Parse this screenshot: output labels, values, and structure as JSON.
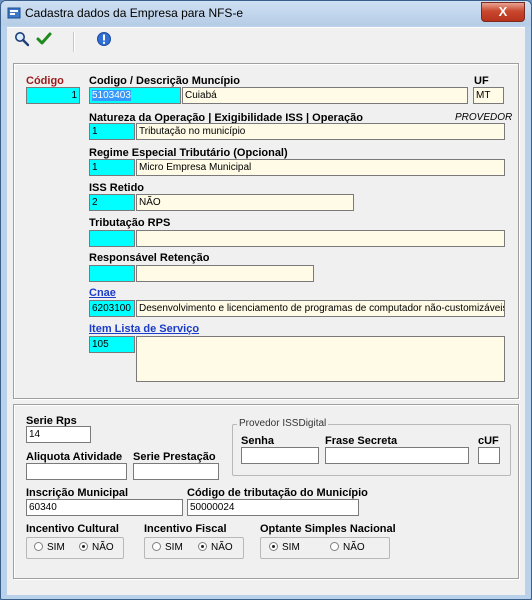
{
  "window": {
    "title": "Cadastra dados da Empresa para NFS-e",
    "close_label": "X"
  },
  "toolbar": {
    "search_icon": "search-icon",
    "confirm_icon": "checkmark-icon",
    "info_icon": "info-icon",
    "confirm_color": "#1e8a1e",
    "info_color": "#2f6fd6"
  },
  "codigo": {
    "label": "Código",
    "value": "1"
  },
  "municipio": {
    "label": "Codigo / Descrição Muncípio",
    "code": "5103403",
    "name": "Cuiabá"
  },
  "uf": {
    "label": "UF",
    "value": "MT"
  },
  "natureza": {
    "label": "Natureza da Operação | Exigibilidade ISS | Operação",
    "note": "PROVEDOR",
    "code": "1",
    "desc": "Tributação no município"
  },
  "regime": {
    "label": "Regime Especial Tributário (Opcional)",
    "code": "1",
    "desc": "Micro Empresa Municipal"
  },
  "iss_retido": {
    "label": "ISS Retido",
    "code": "2",
    "desc": "NÃO"
  },
  "tributacao_rps": {
    "label": "Tributação RPS",
    "code": "",
    "desc": ""
  },
  "responsavel": {
    "label": "Responsável Retenção",
    "code": "",
    "desc": ""
  },
  "cnae": {
    "label": "Cnae",
    "code": "6203100",
    "desc": "Desenvolvimento e licenciamento de programas de computador não-customizáveis"
  },
  "item_lista": {
    "label": "Item Lista de Serviço",
    "code": "105",
    "desc": ""
  },
  "serie_rps": {
    "label": "Serie Rps",
    "value": "14"
  },
  "aliquota": {
    "label": "Aliquota Atividade",
    "value": ""
  },
  "serie_prestacao": {
    "label": "Serie Prestação",
    "value": ""
  },
  "provedor": {
    "title": "Provedor ISSDigital",
    "senha_label": "Senha",
    "senha": "",
    "frase_label": "Frase Secreta",
    "frase": "",
    "cuf_label": "cUF",
    "cuf": ""
  },
  "inscricao": {
    "label": "Inscrição Municipal",
    "value": "60340"
  },
  "cod_tributacao": {
    "label": "Código de tributação do Município",
    "value": "50000024"
  },
  "incentivo_cultural": {
    "label": "Incentivo Cultural",
    "sim": "SIM",
    "nao": "NÃO",
    "selected": "NÃO"
  },
  "incentivo_fiscal": {
    "label": "Incentivo Fiscal",
    "sim": "SIM",
    "nao": "NÃO",
    "selected": "NÃO"
  },
  "optante_simples": {
    "label": "Optante Simples Nacional",
    "sim": "SIM",
    "nao": "NÃO",
    "selected": "SIM"
  }
}
